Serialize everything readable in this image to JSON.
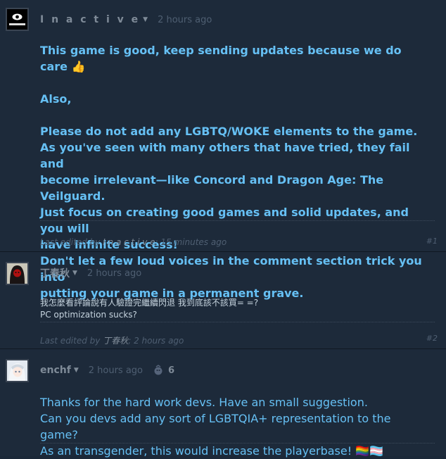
{
  "comments": [
    {
      "author": "I n a c t i v e",
      "time": "2 hours ago",
      "lines": [
        "This game is good, keep sending updates because we do care 👍",
        "Also,",
        "Please do not add any LGBTQ/WOKE elements to the game.",
        "As you've seen with many others that have tried, they fail and",
        "become irrelevant—like Concord and Dragon Age: The Veilguard.",
        "Just focus on creating good games and solid updates, and you will",
        "have infinite success!",
        "Don't let a few loud voices in the comment section trick you into",
        "putting your game in a permanent grave."
      ],
      "edited_prefix": "Last edited by ",
      "edited_by": "I n a c t i v e",
      "edited_suffix": "; 15 minutes ago",
      "number": "#1",
      "avatar_text": "LITTLE NIGHTMARES"
    },
    {
      "author": "丁春秋",
      "time": "2 hours ago",
      "lines": [
        "我怎麼看評論說有人驗證完繼續閃退 我到底該不該買= =?",
        "PC optimization sucks?"
      ],
      "edited_prefix": "Last edited by ",
      "edited_by": "丁春秋",
      "edited_suffix": "; 2 hours ago",
      "number": "#2"
    },
    {
      "author": "enchf",
      "time": "2 hours ago",
      "award_count": "6",
      "award_icon": "award-icon",
      "lines": [
        "Thanks for the hard work devs. Have an small suggestion.",
        "Can you devs add any sort of LGBTQIA+ representation to the game?",
        "As an transgender, this would increase the playerbase! 🏳️‍🌈🏳️‍⚧️"
      ]
    }
  ],
  "colors": {
    "background": "#1d2a3a",
    "comment_text": "#66c0f4",
    "small_text": "#c6d4df",
    "muted": "#4f5f72",
    "author": "#7f8b98"
  }
}
